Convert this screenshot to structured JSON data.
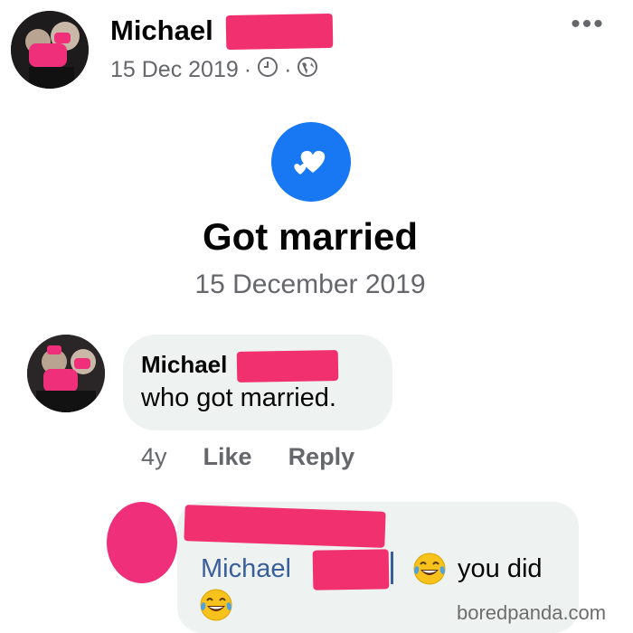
{
  "post": {
    "author_name": "Michael",
    "date": "15 Dec 2019",
    "separator": "·",
    "audience_icon": "globe-icon",
    "time_icon": "clock-icon",
    "more_icon": "more-options-icon",
    "more_label": "•••"
  },
  "life_event": {
    "icon": "hearts-icon",
    "title": "Got married",
    "date": "15 December 2019"
  },
  "comments": [
    {
      "author": "Michael",
      "text": "who got married.",
      "age": "4y",
      "like_label": "Like",
      "reply_label": "Reply"
    },
    {
      "mention": "Michael",
      "text": "you did",
      "emoji": "tears-of-joy-emoji"
    }
  ],
  "watermark": "boredpanda.com",
  "colors": {
    "accent_blue": "#1877f2",
    "redaction_pink": "#f0306f",
    "bubble_gray": "#eef2f1",
    "mention_blue": "#3a5e9a"
  }
}
